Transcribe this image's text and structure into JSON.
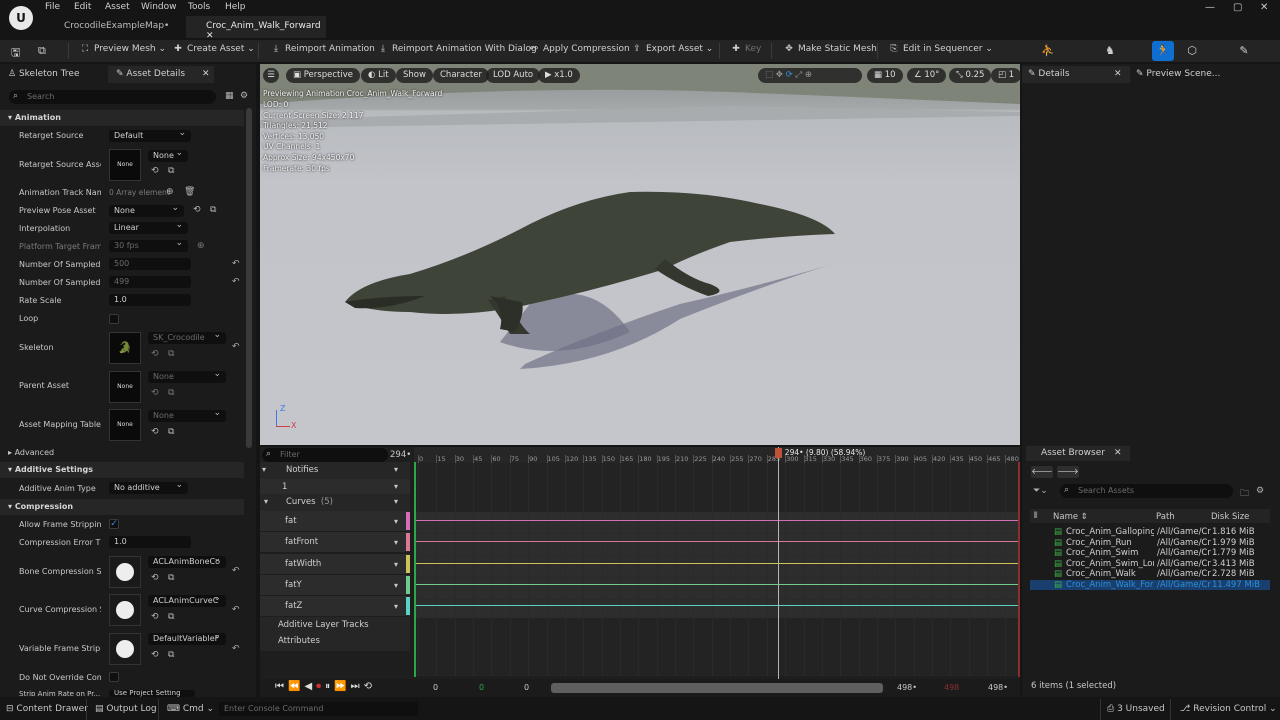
{
  "menu": [
    "File",
    "Edit",
    "Asset",
    "Window",
    "Tools",
    "Help"
  ],
  "tabs": [
    {
      "label": "CrocodileExampleMap•",
      "active": false
    },
    {
      "label": "Croc_Anim_Walk_Forward",
      "active": true
    }
  ],
  "window_controls": {
    "minimize": "—",
    "maximize": "▢",
    "close": "✕"
  },
  "toolbar": {
    "preview_mesh": "Preview Mesh",
    "create_asset": "Create Asset",
    "reimport": "Reimport Animation",
    "reimport_dialog": "Reimport Animation With Dialog",
    "apply_compression": "Apply Compression",
    "export_asset": "Export Asset",
    "key": "Key",
    "make_static_mesh": "Make Static Mesh",
    "edit_in_sequencer": "Edit in Sequencer"
  },
  "left_panel": {
    "tabs": [
      "Skeleton Tree",
      "Asset Details"
    ],
    "search_placeholder": "Search",
    "sections": {
      "animation": "Animation",
      "advanced": "Advanced",
      "additive": "Additive Settings",
      "compression": "Compression"
    },
    "props": {
      "retarget_source": {
        "label": "Retarget Source",
        "value": "Default"
      },
      "retarget_source_asset": {
        "label": "Retarget Source Asset",
        "value": "None",
        "thumb": "None"
      },
      "anim_track_names": {
        "label": "Animation Track Nam...",
        "value": "0 Array element"
      },
      "preview_pose_asset": {
        "label": "Preview Pose Asset",
        "value": "None"
      },
      "interpolation": {
        "label": "Interpolation",
        "value": "Linear"
      },
      "platform_target_frame": {
        "label": "Platform Target Fram...",
        "value": "30 fps"
      },
      "num_sampled_keys": {
        "label": "Number Of Sampled K...",
        "value": "500"
      },
      "num_sampled_frames": {
        "label": "Number Of Sampled F...",
        "value": "499"
      },
      "rate_scale": {
        "label": "Rate Scale",
        "value": "1.0"
      },
      "loop": {
        "label": "Loop"
      },
      "skeleton": {
        "label": "Skeleton",
        "value": "SK_Crocodile"
      },
      "parent_asset": {
        "label": "Parent Asset",
        "value": "None",
        "thumb": "None"
      },
      "asset_mapping_table": {
        "label": "Asset Mapping Table",
        "value": "None",
        "thumb": "None"
      },
      "additive_anim_type": {
        "label": "Additive Anim Type",
        "value": "No additive"
      },
      "allow_frame_stripping": {
        "label": "Allow Frame Stripping"
      },
      "compression_error_threshold": {
        "label": "Compression Error Th...",
        "value": "1.0"
      },
      "bone_compression": {
        "label": "Bone Compression Se...",
        "value": "ACLAnimBoneCo"
      },
      "curve_compression": {
        "label": "Curve Compression S...",
        "value": "ACLAnimCurveC"
      },
      "variable_frame_stripping": {
        "label": "Variable Frame Strippi...",
        "value": "DefaultVariableF"
      },
      "do_not_override": {
        "label": "Do Not Override Comp..."
      },
      "strip_anim_rate": {
        "label": "Strip Anim Rate on Pr...",
        "value": "Use Project Setting"
      }
    }
  },
  "viewport": {
    "buttons": {
      "perspective": "Perspective",
      "lit": "Lit",
      "show": "Show",
      "character": "Character",
      "lod": "LOD Auto",
      "speed": "x1.0"
    },
    "right_controls": {
      "grid": "10",
      "angle": "10°",
      "scale": "0.25",
      "cam": "1"
    },
    "overlay": [
      "Previewing Animation Croc_Anim_Walk_Forward",
      "LOD: 0",
      "Current Screen Size: 2.117",
      "Triangles: 21,512",
      "Vertices: 13,050",
      "UV Channels: 1",
      "Approx Size: 94x450x70",
      "Framerate: 30 fps"
    ],
    "axis": {
      "z": "Z",
      "x": "X"
    }
  },
  "timeline": {
    "filter_placeholder": "Filter",
    "frame_count": "294•",
    "notifies": "Notifies",
    "notify_track": "1",
    "curves": "Curves",
    "curves_count": "(5)",
    "curve_items": [
      {
        "name": "fat",
        "color": "#d26fb8"
      },
      {
        "name": "fatFront",
        "color": "#d87a96"
      },
      {
        "name": "fatWidth",
        "color": "#cdc35a"
      },
      {
        "name": "fatY",
        "color": "#6fcc8d"
      },
      {
        "name": "fatZ",
        "color": "#5ad3c4"
      }
    ],
    "additive_layer": "Additive Layer Tracks",
    "attributes": "Attributes",
    "playhead_label": "294• (9.80) (58.94%)",
    "playhead_frame": 294,
    "total_frames": 498,
    "ticks": [
      "0",
      "15",
      "30",
      "45",
      "60",
      "75",
      "90",
      "105",
      "120",
      "135",
      "150",
      "165",
      "180",
      "195",
      "210",
      "225",
      "240",
      "255",
      "270",
      "285",
      "300",
      "315",
      "330",
      "345",
      "360",
      "375",
      "390",
      "405",
      "420",
      "435",
      "450",
      "465",
      "480"
    ],
    "footer": {
      "start": "0",
      "green": "0",
      "range_start": "0",
      "range_end": "498•",
      "red": "498",
      "end": "498•"
    }
  },
  "right_panel": {
    "tabs": [
      "Details",
      "Preview Scene..."
    ],
    "asset_browser": "Asset Browser",
    "search_placeholder": "Search Assets",
    "columns": {
      "name": "Name",
      "path": "Path",
      "size": "Disk Size"
    },
    "items": [
      {
        "name": "Croc_Anim_Galloping",
        "path": "/All/Game/Cr",
        "size": "1.816 MiB",
        "selected": false
      },
      {
        "name": "Croc_Anim_Run",
        "path": "/All/Game/Cr",
        "size": "1.979 MiB",
        "selected": false
      },
      {
        "name": "Croc_Anim_Swim",
        "path": "/All/Game/Cr",
        "size": "1.779 MiB",
        "selected": false
      },
      {
        "name": "Croc_Anim_Swim_Long",
        "path": "/All/Game/Cr",
        "size": "3.413 MiB",
        "selected": false
      },
      {
        "name": "Croc_Anim_Walk",
        "path": "/All/Game/Cr",
        "size": "2.728 MiB",
        "selected": false
      },
      {
        "name": "Croc_Anim_Walk_Forw",
        "path": "/All/Game/Cr",
        "size": "11.497 MiB",
        "selected": true
      }
    ],
    "count": "6 items (1 selected)"
  },
  "statusbar": {
    "content_drawer": "Content Drawer",
    "output_log": "Output Log",
    "cmd": "Cmd",
    "console_placeholder": "Enter Console Command",
    "unsaved": "3 Unsaved",
    "revision": "Revision Control"
  }
}
